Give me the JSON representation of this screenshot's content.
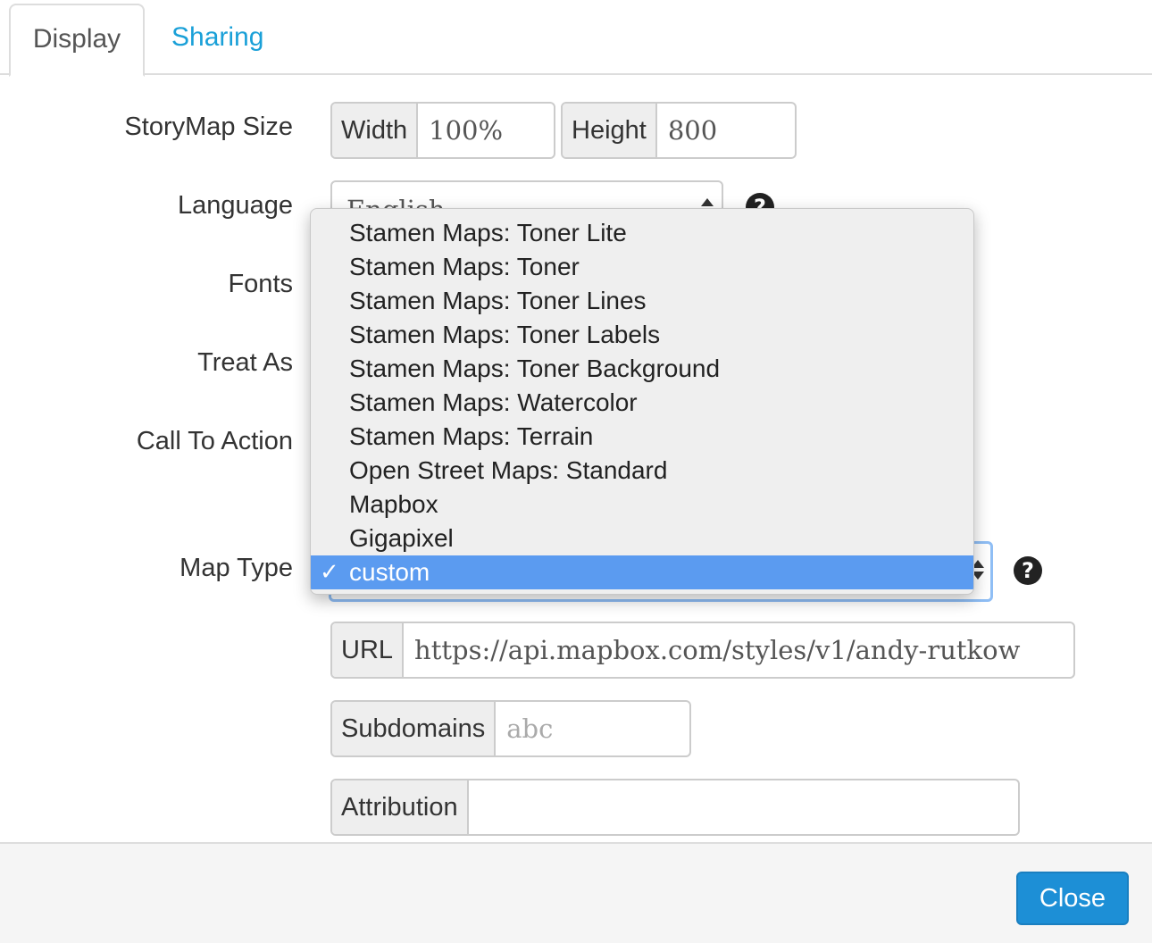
{
  "tabs": [
    {
      "label": "Display"
    },
    {
      "label": "Sharing"
    }
  ],
  "labels": {
    "storymap_size": "StoryMap Size",
    "language": "Language",
    "fonts": "Fonts",
    "treat_as": "Treat As",
    "call_to_action": "Call To Action",
    "map_type": "Map Type"
  },
  "size": {
    "width_label": "Width",
    "width_value": "100%",
    "height_label": "Height",
    "height_value": "800"
  },
  "language": {
    "selected": "English"
  },
  "map_type": {
    "options": [
      "Stamen Maps: Toner Lite",
      "Stamen Maps: Toner",
      "Stamen Maps: Toner Lines",
      "Stamen Maps: Toner Labels",
      "Stamen Maps: Toner Background",
      "Stamen Maps: Watercolor",
      "Stamen Maps: Terrain",
      "Open Street Maps: Standard",
      "Mapbox",
      "Gigapixel",
      "custom"
    ],
    "selected": "custom",
    "check_glyph": "✓"
  },
  "url": {
    "label": "URL",
    "value": "https://api.mapbox.com/styles/v1/andy-rutkow"
  },
  "subdomains": {
    "label": "Subdomains",
    "placeholder": "abc"
  },
  "attribution": {
    "label": "Attribution",
    "value": ""
  },
  "help_glyph": "?",
  "footer": {
    "close_label": "Close"
  },
  "colors": {
    "accent": "#1aa0d8",
    "button": "#1d8fd6",
    "selection": "#5b9bf0"
  }
}
